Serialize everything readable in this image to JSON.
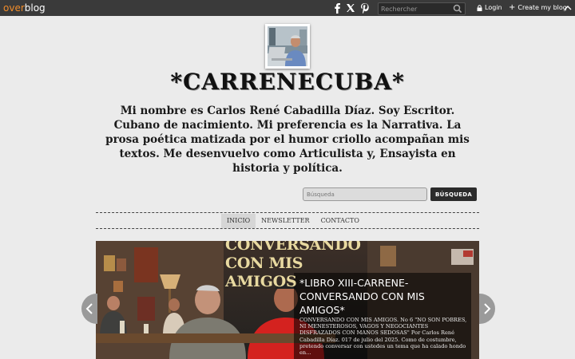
{
  "topbar": {
    "logo_over": "over",
    "logo_blog": "blog",
    "social_icons": [
      "facebook-icon",
      "x-icon",
      "pinterest-icon"
    ],
    "search_placeholder": "Rechercher",
    "login_label": "Login",
    "create_label": "Create my blog",
    "colors": {
      "bar": "#3a3a3a",
      "logo_accent": "#f08c2a"
    }
  },
  "header": {
    "title": "*CARRENECUBA*",
    "description": "Mi nombre es Carlos René Cabadilla Díaz. Soy Escritor. Cubano de nacimiento. Mi preferencia es la Narrativa. La prosa poética matizada por el humor criollo acompañan mis textos. Me desenvuelvo como Articulista y, Ensayista en historia y política."
  },
  "blog_search": {
    "placeholder": "Búsqueda",
    "button_label": "BÚSQUEDA"
  },
  "nav": {
    "items": [
      {
        "label": "INICIO",
        "active": true
      },
      {
        "label": "NEWSLETTER",
        "active": false
      },
      {
        "label": "CONTACTO",
        "active": false
      }
    ]
  },
  "slider": {
    "image_headline_line1": "CONVERSANDO",
    "image_headline_line2": "CON MIS AMIGOS",
    "title": "*LIBRO XIII-CARRENE-CONVERSANDO CON MIS AMIGOS*",
    "excerpt": "CONVERSANDO CON MIS AMIGOS. No 6 \"NO SON POBRES, NI MENESTEROSOS, VAGOS Y NEGOCIANTES DISFRAZADOS CON MANOS SEDOSAS\" Por Carlos René Cabadilla Díaz. 017 de julio del 2025. Como de costumbre, pretendo conversar con ustedes un tema que ha calado hondo en...",
    "prev_icon": "chevron-left-icon",
    "next_icon": "chevron-right-icon"
  }
}
